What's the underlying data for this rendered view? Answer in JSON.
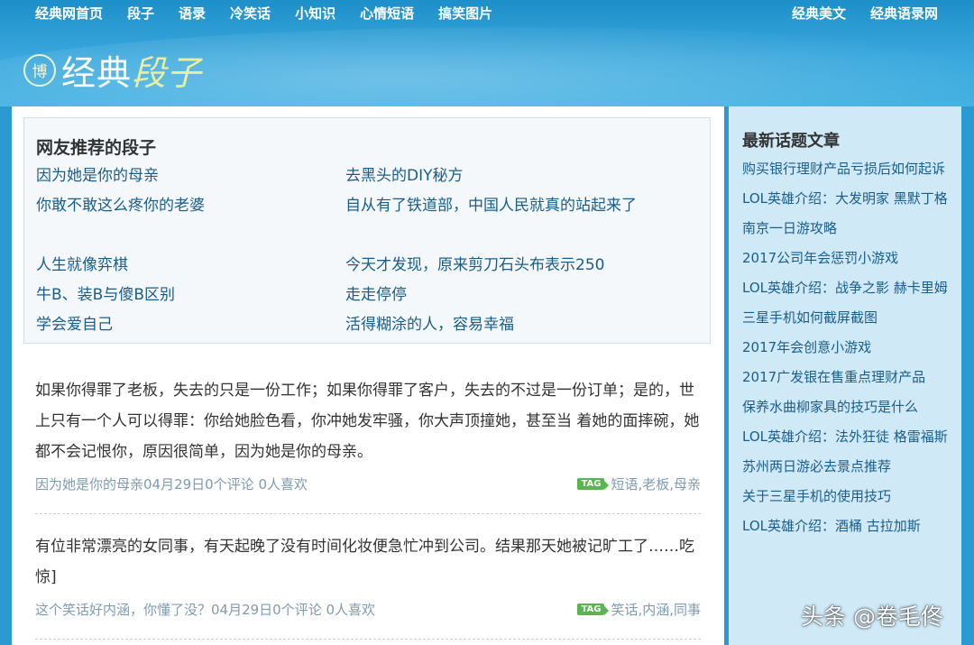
{
  "nav": {
    "left": [
      "经典网首页",
      "段子",
      "语录",
      "冷笑话",
      "小知识",
      "心情短语",
      "搞笑图片"
    ],
    "right": [
      "经典美文",
      "经典语录网"
    ]
  },
  "logo": {
    "badge": "博",
    "main": "经典",
    "accent": "段子"
  },
  "recommend": {
    "title": "网友推荐的段子",
    "col1": [
      "因为她是你的母亲",
      "你敢不敢这么疼你的老婆",
      "人生就像弈棋",
      "牛B、装B与傻B区别",
      "学会爱自己"
    ],
    "col2": [
      "去黑头的DIY秘方",
      "自从有了铁道部，中国人民就真的站起来了",
      "今天才发现，原来剪刀石头布表示250",
      "走走停停",
      "活得糊涂的人，容易幸福"
    ]
  },
  "posts": [
    {
      "text": "如果你得罪了老板，失去的只是一份工作；如果你得罪了客户，失去的不过是一份订单；是的，世上只有一个人可以得罪：你给她脸色看，你冲她发牢骚，你大声顶撞她，甚至当 着她的面摔碗，她都不会记恨你，原因很简单，因为她是你的母亲。",
      "meta": "因为她是你的母亲04月29日0个评论 0人喜欢",
      "tag_label": "TAG",
      "tags": "短语,老板,母亲"
    },
    {
      "text": "有位非常漂亮的女同事，有天起晚了没有时间化妆便急忙冲到公司。结果那天她被记旷工了……吃惊]",
      "meta": "这个笑话好内涵，你懂了没？04月29日0个评论 0人喜欢",
      "tag_label": "TAG",
      "tags": "笑话,内涵,同事"
    }
  ],
  "sidebar": {
    "title": "最新话题文章",
    "items": [
      "购买银行理财产品亏损后如何起诉",
      "LOL英雄介绍：大发明家 黑默丁格",
      "南京一日游攻略",
      "2017公司年会惩罚小游戏",
      "LOL英雄介绍：战争之影 赫卡里姆",
      "三星手机如何截屏截图",
      "2017年会创意小游戏",
      "2017广发银在售重点理财产品",
      "保养水曲柳家具的技巧是什么",
      "LOL英雄介绍：法外狂徒 格雷福斯",
      "苏州两日游必去景点推荐",
      "关于三星手机的使用技巧",
      "LOL英雄介绍：酒桶 古拉加斯"
    ]
  },
  "watermark": "头条 @卷毛佟"
}
